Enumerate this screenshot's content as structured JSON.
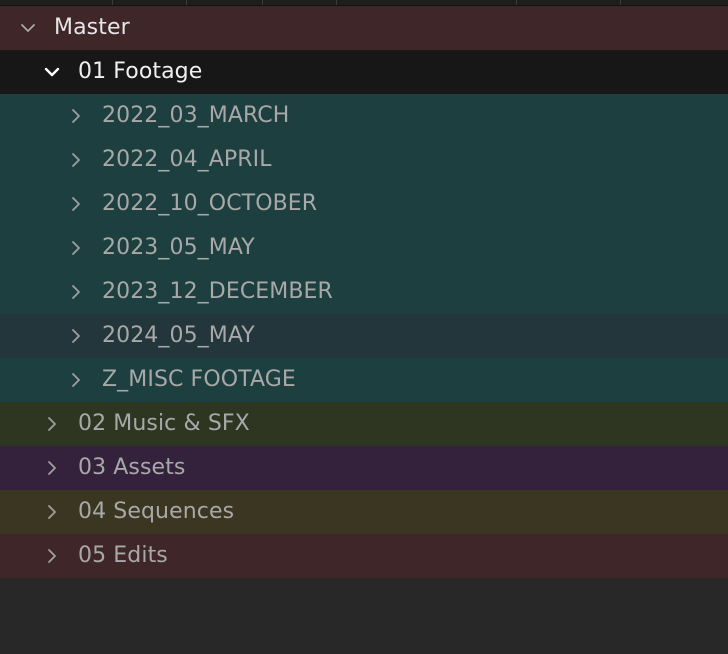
{
  "tree": {
    "master": {
      "label": "Master",
      "color": "#3f2628",
      "expanded": true
    },
    "footage": {
      "label": "01 Footage",
      "color": "#171717",
      "expanded": true,
      "children": [
        {
          "label": "2022_03_MARCH",
          "color": "#1d3f3f"
        },
        {
          "label": "2022_04_APRIL",
          "color": "#1d3f3f"
        },
        {
          "label": "2022_10_OCTOBER",
          "color": "#1d3f3f"
        },
        {
          "label": "2023_05_MAY",
          "color": "#1d3f3f"
        },
        {
          "label": "2023_12_DECEMBER",
          "color": "#1d3f3f"
        },
        {
          "label": "2024_05_MAY",
          "color": "#22363c"
        },
        {
          "label": "Z_MISC FOOTAGE",
          "color": "#1d3f3f"
        }
      ]
    },
    "bins": [
      {
        "label": "02 Music & SFX",
        "color": "#2e3622"
      },
      {
        "label": "03 Assets",
        "color": "#34223d"
      },
      {
        "label": "04 Sequences",
        "color": "#3a3622"
      },
      {
        "label": "05 Edits",
        "color": "#3f2628"
      }
    ]
  },
  "colors": {
    "panel_bg": "#282828",
    "text_bright": "#e6e6e6",
    "text_dim": "#a8a8a8"
  },
  "icons": {
    "expanded": "chevron-down-icon",
    "collapsed": "chevron-right-icon"
  }
}
